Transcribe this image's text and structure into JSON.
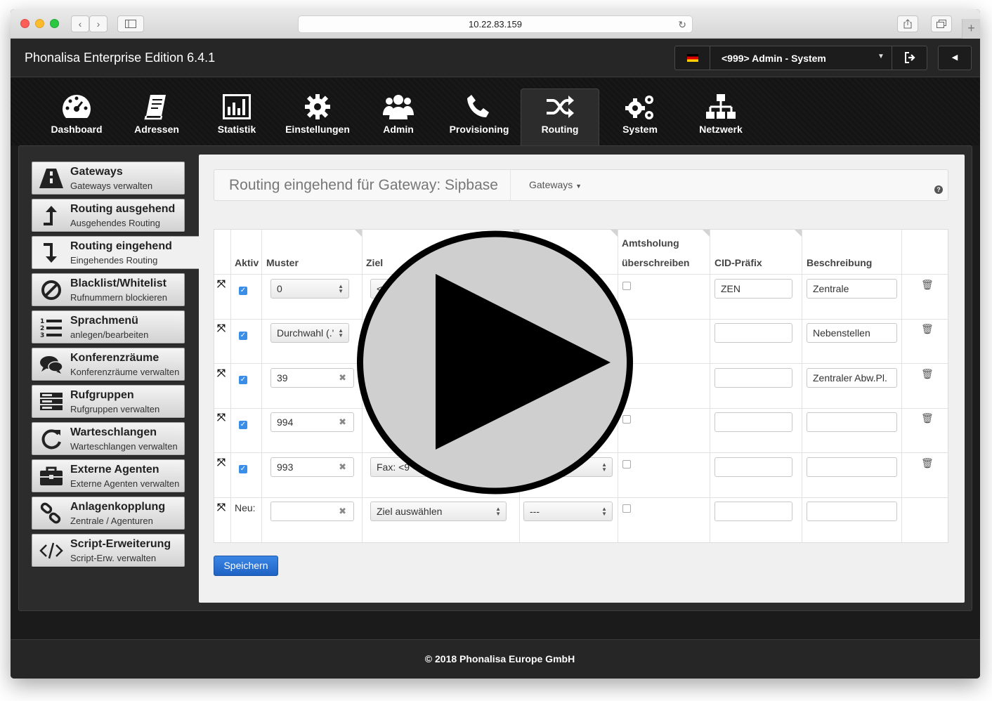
{
  "browser": {
    "url": "10.22.83.159"
  },
  "app": {
    "title": "Phonalisa Enterprise Edition 6.4.1",
    "user": "<999> Admin - System"
  },
  "nav": [
    "Dashboard",
    "Adressen",
    "Statistik",
    "Einstellungen",
    "Admin",
    "Provisioning",
    "Routing",
    "System",
    "Netzwerk"
  ],
  "active_nav": "Routing",
  "sidebar": [
    {
      "title": "Gateways",
      "sub": "Gateways verwalten"
    },
    {
      "title": "Routing ausgehend",
      "sub": "Ausgehendes Routing"
    },
    {
      "title": "Routing eingehend",
      "sub": "Eingehendes Routing"
    },
    {
      "title": "Blacklist/Whitelist",
      "sub": "Rufnummern blockieren"
    },
    {
      "title": "Sprachmenü",
      "sub": "anlegen/bearbeiten"
    },
    {
      "title": "Konferenzräume",
      "sub": "Konferenzräume verwalten"
    },
    {
      "title": "Rufgruppen",
      "sub": "Rufgruppen verwalten"
    },
    {
      "title": "Warteschlangen",
      "sub": "Warteschlangen verwalten"
    },
    {
      "title": "Externe Agenten",
      "sub": "Externe Agenten verwalten"
    },
    {
      "title": "Anlagenkopplung",
      "sub": "Zentrale / Agenturen"
    },
    {
      "title": "Script-Erweiterung",
      "sub": "Script-Erw. verwalten"
    }
  ],
  "panel": {
    "title": "Routing eingehend für Gateway: Sipbase",
    "gateways_menu": "Gateways"
  },
  "table": {
    "headers": {
      "aktiv": "Aktiv",
      "muster": "Muster",
      "ziel": "Ziel",
      "amts1": "Amtsholung",
      "amts2": "überschreiben",
      "cid": "CID-Präfix",
      "beschreibung": "Beschreibung"
    },
    "rows": [
      {
        "muster": "0",
        "ziel": "<",
        "cid": "ZEN",
        "beschreibung": "Zentrale"
      },
      {
        "muster": "Durchwahl (.'",
        "ziel": "",
        "cid": "",
        "beschreibung": "Nebenstellen"
      },
      {
        "muster": "39",
        "ziel": "",
        "cid": "",
        "beschreibung": "Zentraler Abw.Pl."
      },
      {
        "muster": "994",
        "ziel": "",
        "cid": "",
        "beschreibung": ""
      },
      {
        "muster": "993",
        "ziel": "Fax: <9",
        "cid": "",
        "beschreibung": ""
      }
    ],
    "new_row": {
      "label": "Neu:",
      "ziel_placeholder": "Ziel auswählen",
      "option_placeholder": "---"
    }
  },
  "save_label": "Speichern",
  "footer": "© 2018 Phonalisa Europe GmbH",
  "colors": {
    "accent": "#2a6fd6",
    "header_bg": "#262626",
    "checkbox": "#3b8ee8"
  }
}
